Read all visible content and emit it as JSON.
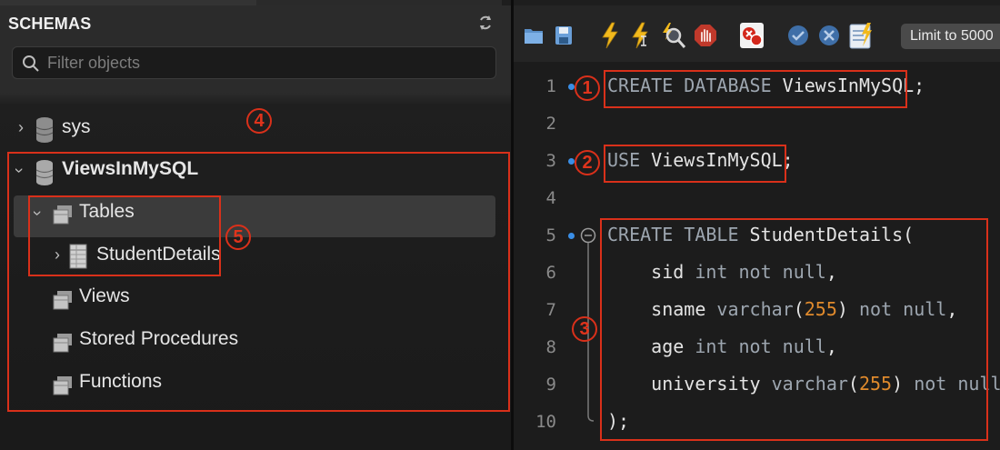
{
  "sidebar": {
    "title": "SCHEMAS",
    "filter_placeholder": "Filter objects",
    "schemas": [
      {
        "name": "sys"
      },
      {
        "name": "ViewsInMySQL"
      }
    ],
    "tree": {
      "tables": "Tables",
      "table_item": "StudentDetails",
      "views": "Views",
      "procedures": "Stored Procedures",
      "functions": "Functions"
    }
  },
  "toolbar": {
    "limit_label": "Limit to 5000",
    "icons": [
      "folder-icon",
      "save-icon",
      "lightning-icon",
      "lightning-cursor-icon",
      "magnify-icon",
      "stop-icon",
      "toggle-error-icon",
      "commit-icon",
      "rollback-icon",
      "beautify-icon"
    ]
  },
  "editor": {
    "line_numbers": [
      "1",
      "2",
      "3",
      "4",
      "5",
      "6",
      "7",
      "8",
      "9",
      "10"
    ],
    "lines": {
      "l1_kw1": "CREATE",
      "l1_kw2": "DATABASE",
      "l1_rest": " ViewsInMySQL;",
      "l3_kw": "USE",
      "l3_rest": " ViewsInMySQL;",
      "l5_kw1": "CREATE",
      "l5_kw2": "TABLE",
      "l5_rest": " StudentDetails(",
      "l6_a": "    sid ",
      "l6_kw1": "int",
      "l6_kw2": "not null",
      "l6_end": ",",
      "l7_a": "    sname ",
      "l7_kw1": "varchar",
      "l7_p1": "(",
      "l7_num": "255",
      "l7_p2": ") ",
      "l7_kw2": "not null",
      "l7_end": ",",
      "l8_a": "    age ",
      "l8_kw1": "int",
      "l8_kw2": "not null",
      "l8_end": ",",
      "l9_a": "    university ",
      "l9_kw1": "varchar",
      "l9_p1": "(",
      "l9_num": "255",
      "l9_p2": ") ",
      "l9_kw2": "not null",
      "l10": ");"
    }
  },
  "annotations": {
    "b1": "1",
    "b2": "2",
    "b3": "3",
    "b4": "4",
    "b5": "5"
  },
  "colors": {
    "annotation": "#d9301a",
    "keyword": "#9da6b0",
    "number": "#e08a2c"
  }
}
